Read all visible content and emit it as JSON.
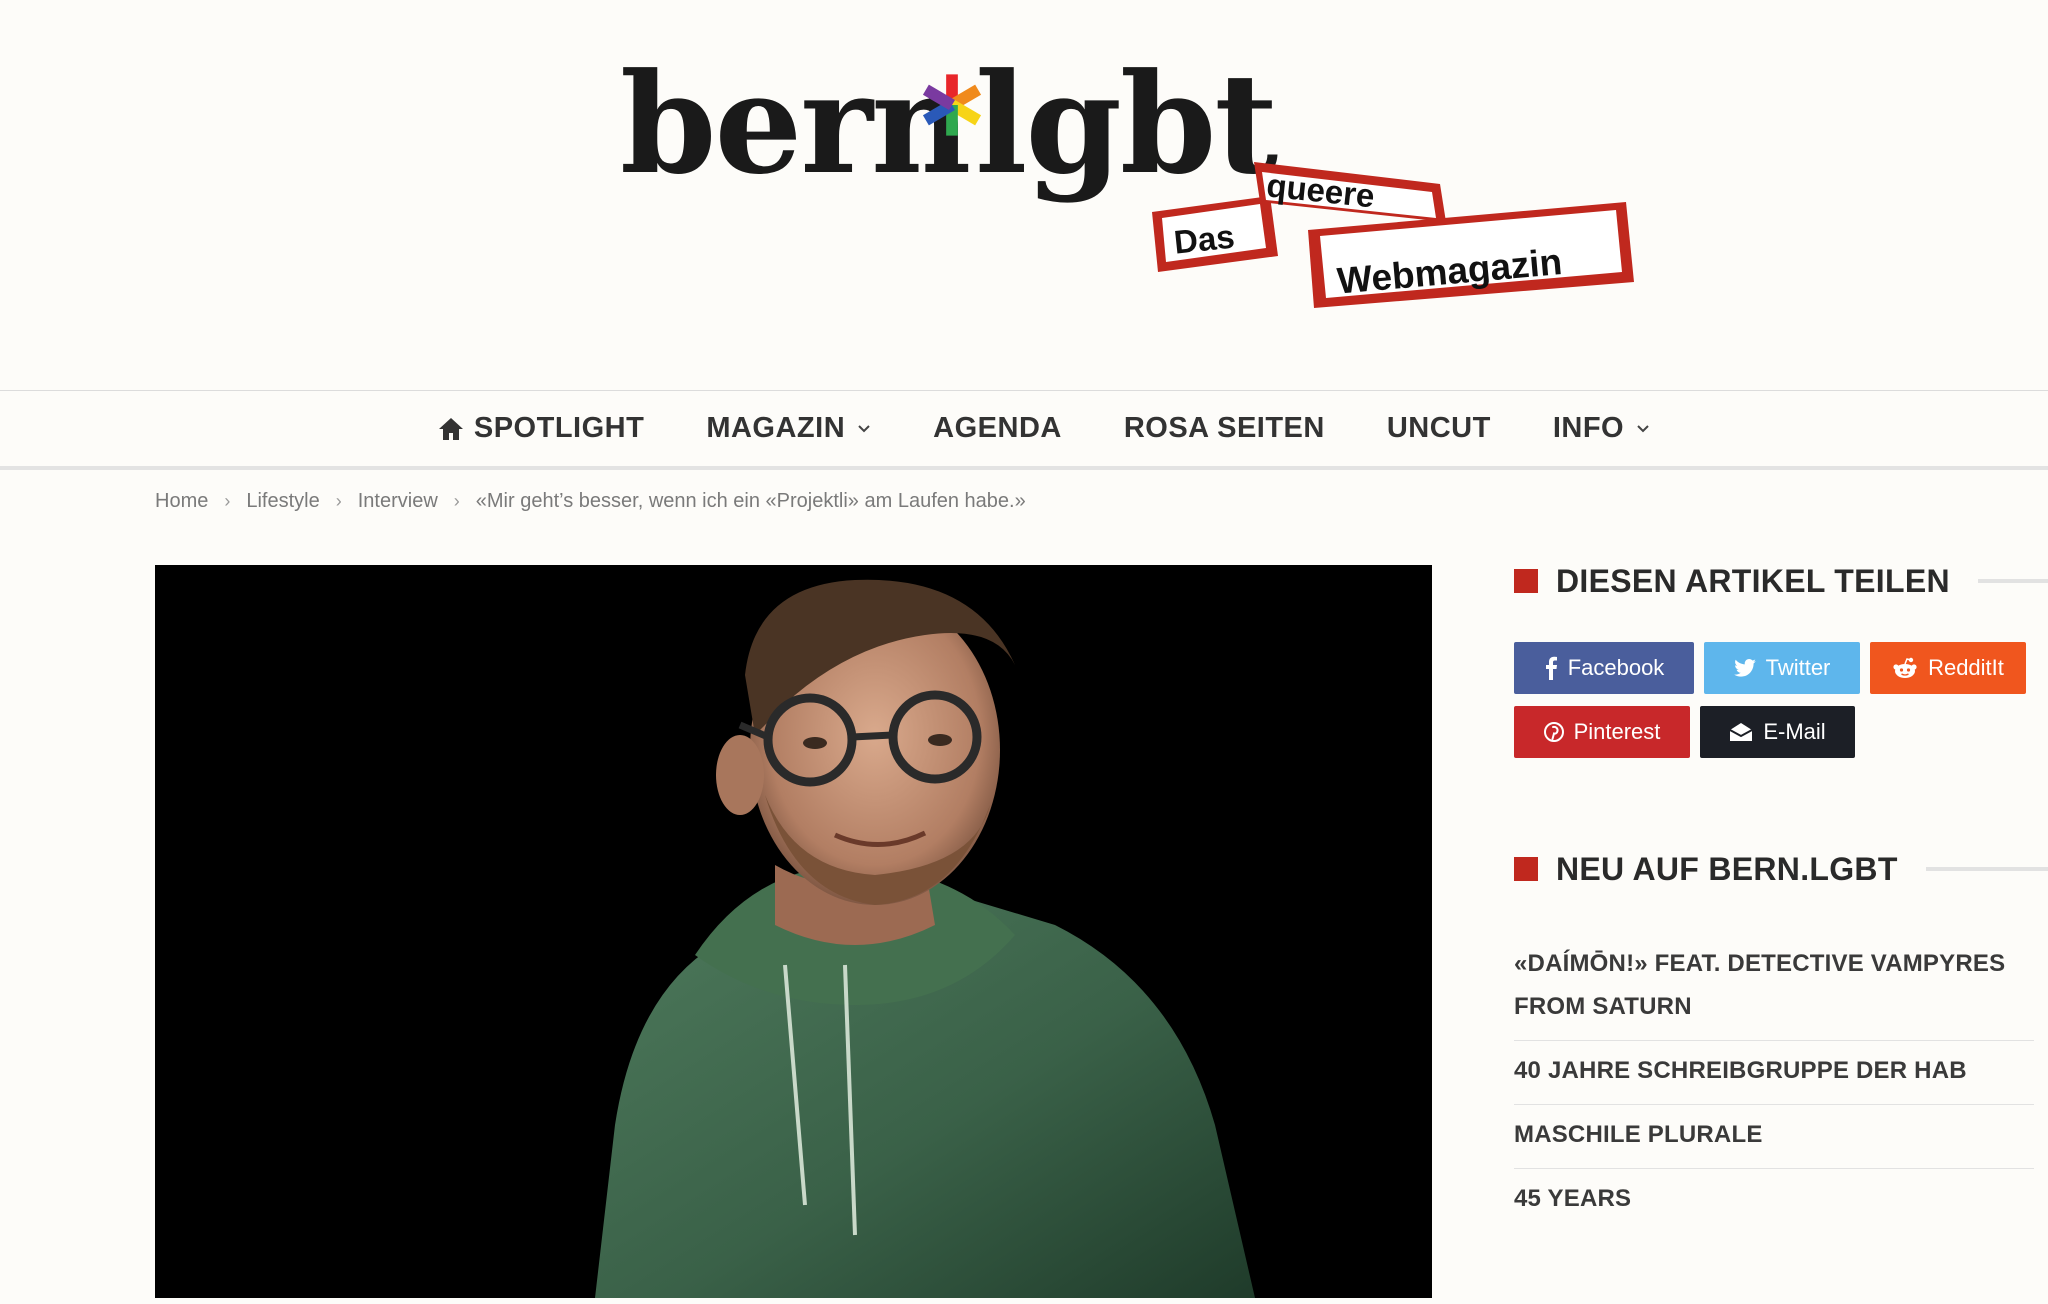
{
  "brand": {
    "part1": "bern",
    "part2": "lgbt",
    "tagline_1": "Das",
    "tagline_2": "queere",
    "tagline_3": "Webmagazin",
    "accent": "#c0281e"
  },
  "nav": {
    "items": [
      {
        "label": "SPOTLIGHT",
        "icon": "home-icon"
      },
      {
        "label": "MAGAZIN",
        "dropdown": true
      },
      {
        "label": "AGENDA"
      },
      {
        "label": "ROSA SEITEN"
      },
      {
        "label": "UNCUT"
      },
      {
        "label": "INFO",
        "dropdown": true
      }
    ]
  },
  "breadcrumb": {
    "items": [
      "Home",
      "Lifestyle",
      "Interview",
      "«Mir geht’s besser, wenn ich ein «Projektli» am Laufen habe.»"
    ]
  },
  "sidebar": {
    "share_title": "DIESEN ARTIKEL TEILEN",
    "share_buttons": [
      {
        "label": "Facebook",
        "icon": "facebook-icon",
        "color": "#4a5e9c"
      },
      {
        "label": "Twitter",
        "icon": "twitter-icon",
        "color": "#5eb6ec"
      },
      {
        "label": "RedditIt",
        "icon": "reddit-icon",
        "color": "#f0561e"
      },
      {
        "label": "Pinterest",
        "icon": "pinterest-icon",
        "color": "#c8282a"
      },
      {
        "label": "E-Mail",
        "icon": "email-icon",
        "color": "#1c1f26"
      }
    ],
    "news_title": "NEU AUF BERN.LGBT",
    "news_items": [
      "«DAÍMŌN!» FEAT. DETECTIVE VAMPYRES FROM SATURN",
      "40 JAHRE SCHREIBGRUPPE DER HAB",
      "MASCHILE PLURALE",
      "45 YEARS"
    ]
  }
}
